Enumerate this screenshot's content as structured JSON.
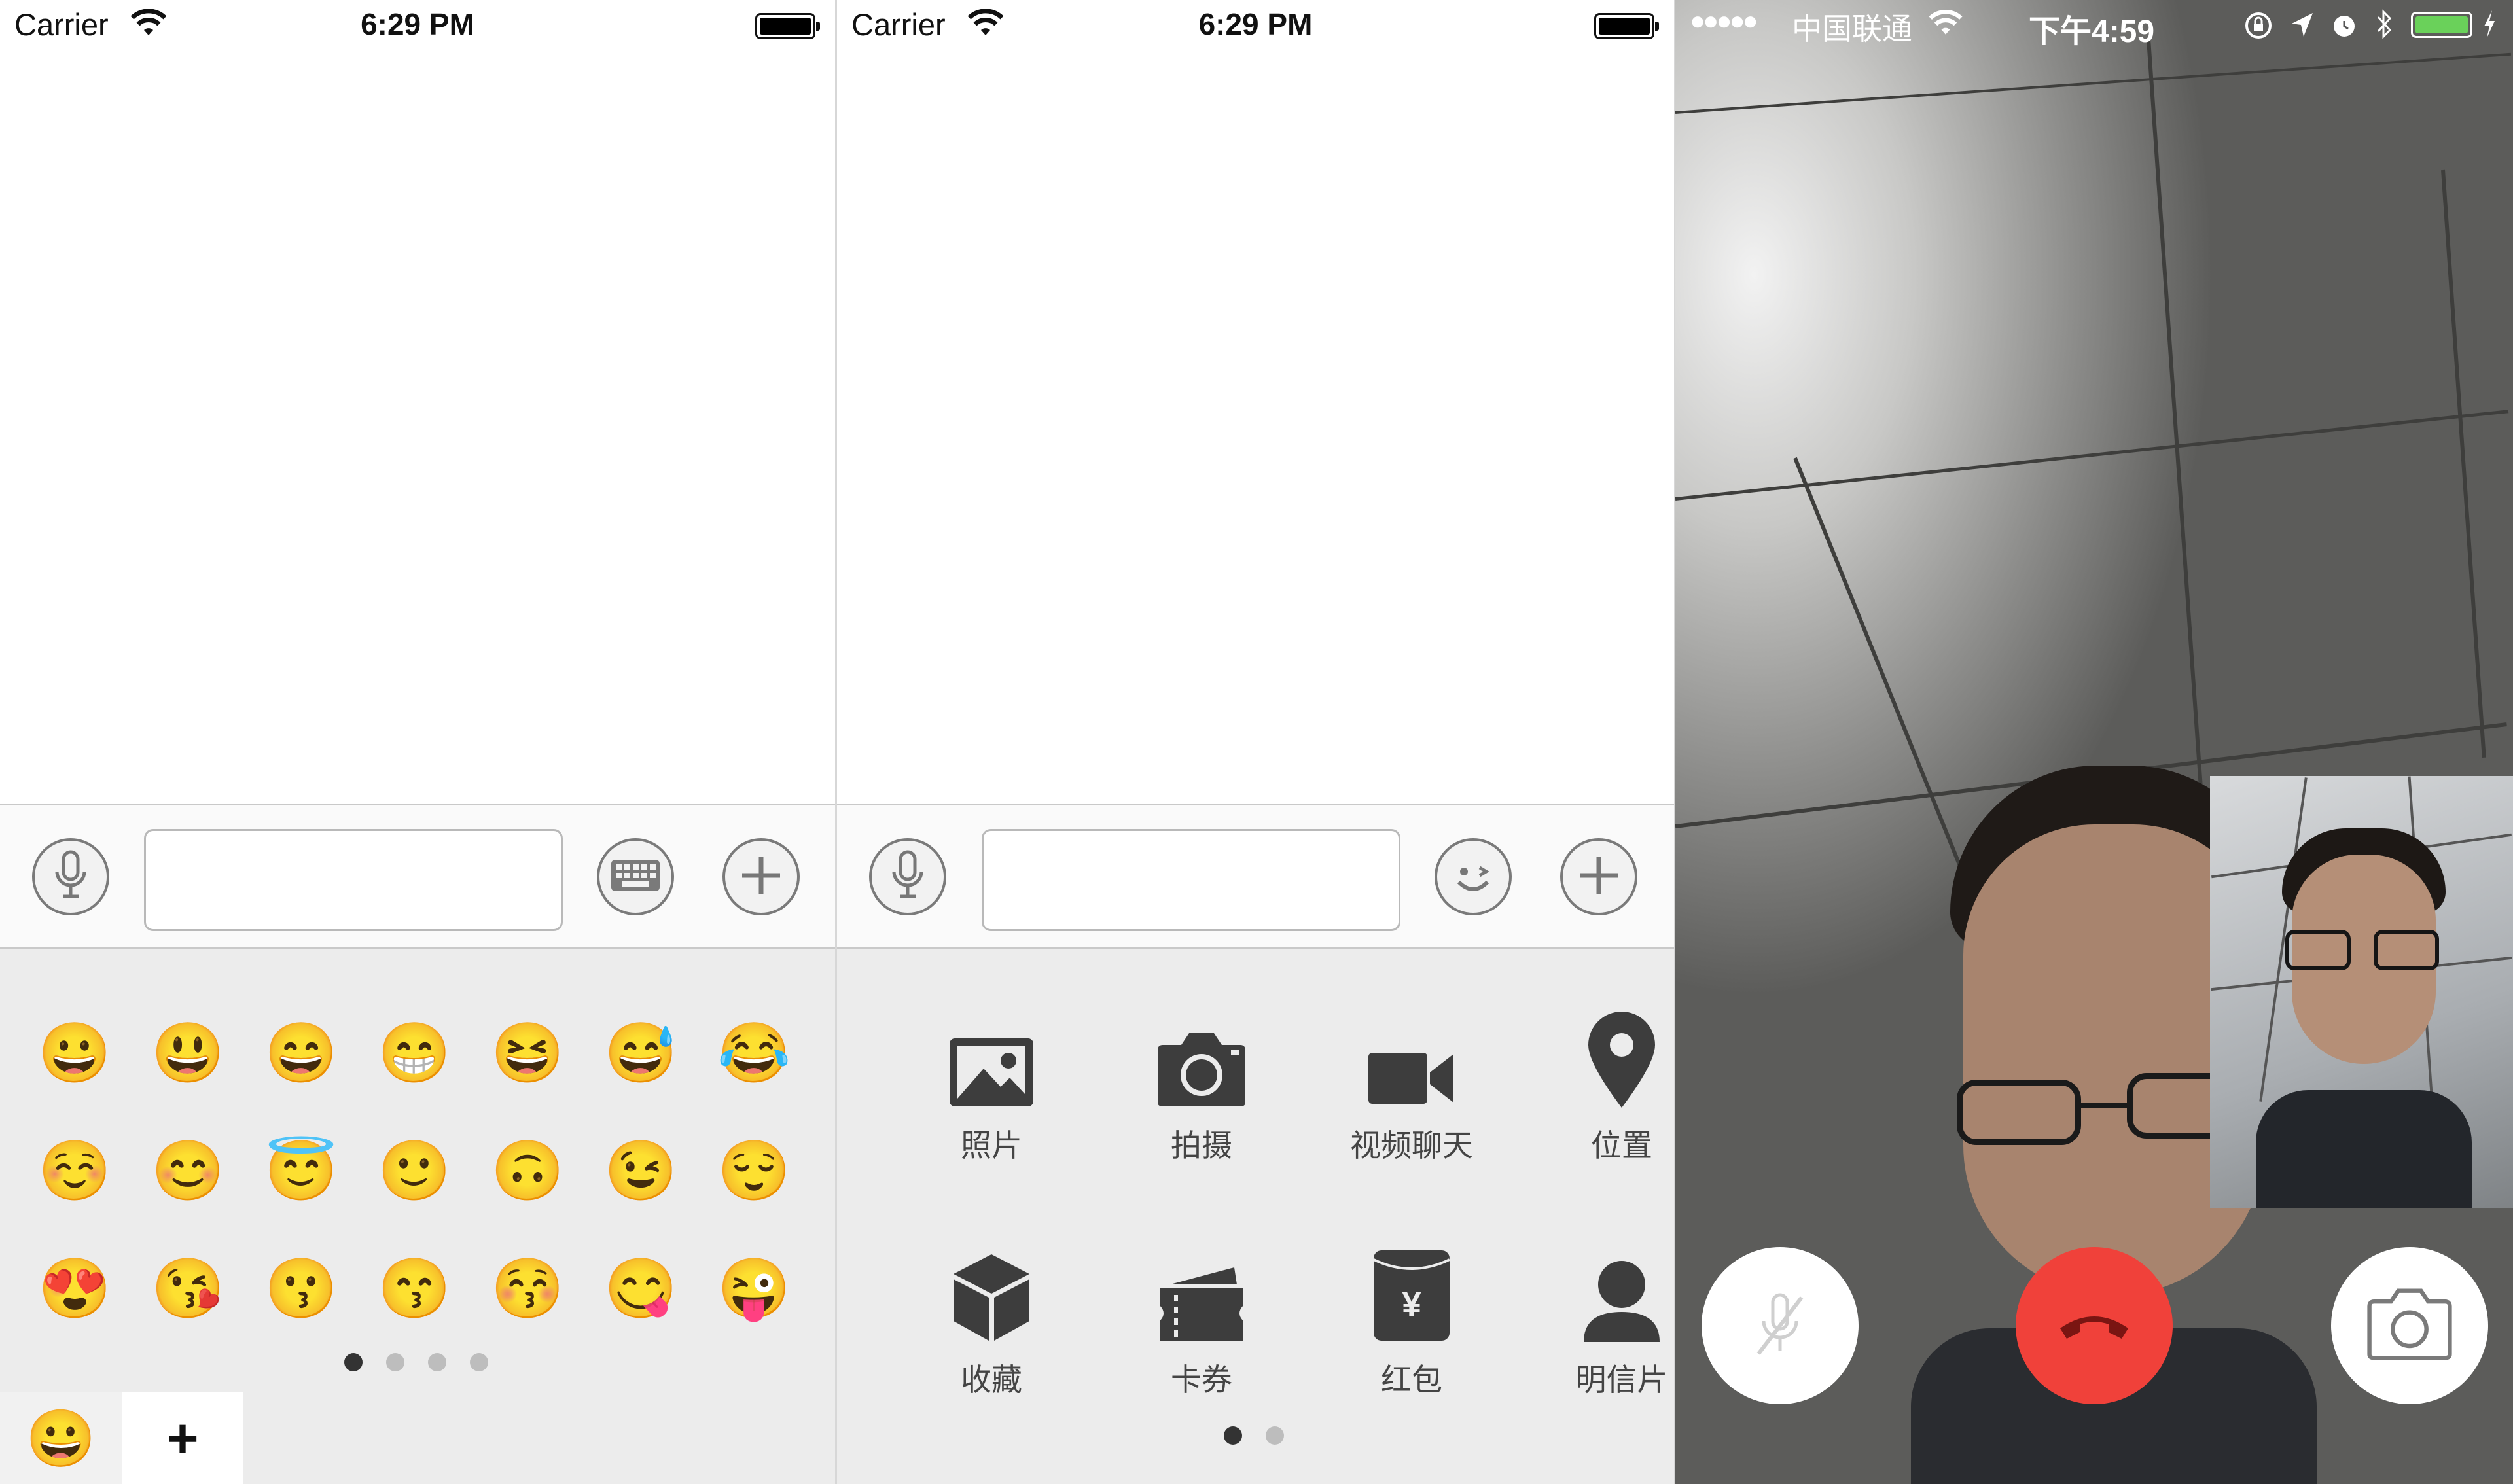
{
  "panel_emoji": {
    "status": {
      "carrier": "Carrier",
      "time": "6:29 PM"
    },
    "toolbar": {
      "voice_icon": "microphone-icon",
      "keyboard_icon": "keyboard-icon",
      "more_icon": "plus-circle-icon"
    },
    "emojis": [
      "😀",
      "😃",
      "😄",
      "😁",
      "😆",
      "😅",
      "😂",
      "☺️",
      "😊",
      "😇",
      "🙂",
      "🙃",
      "😉",
      "😌",
      "😍",
      "😘",
      "😗",
      "😙",
      "😚",
      "😋",
      "😜"
    ],
    "page_count": 4,
    "active_page": 1,
    "tabs": {
      "emoji_tab": "😀",
      "add_tab": "+"
    }
  },
  "panel_more": {
    "status": {
      "carrier": "Carrier",
      "time": "6:29 PM"
    },
    "toolbar": {
      "voice_icon": "microphone-icon",
      "emoji_icon": "wink-face-icon",
      "more_icon": "plus-circle-icon"
    },
    "items": [
      {
        "label": "照片",
        "icon": "photo-icon"
      },
      {
        "label": "拍摄",
        "icon": "camera-icon"
      },
      {
        "label": "视频聊天",
        "icon": "video-camera-icon"
      },
      {
        "label": "位置",
        "icon": "location-pin-icon"
      },
      {
        "label": "收藏",
        "icon": "cube-icon"
      },
      {
        "label": "卡券",
        "icon": "ticket-icon"
      },
      {
        "label": "红包",
        "icon": "red-envelope-icon"
      },
      {
        "label": "明信片",
        "icon": "person-icon"
      }
    ],
    "page_count": 2,
    "active_page": 1
  },
  "panel_video": {
    "status": {
      "signal": "●●●●●",
      "carrier": "中国联通",
      "time": "下午4:59"
    },
    "buttons": {
      "mute": "mic-off-icon",
      "hangup": "phone-hangup-icon",
      "switch_camera": "camera-switch-icon"
    },
    "colors": {
      "hangup": "#f0413a"
    }
  }
}
